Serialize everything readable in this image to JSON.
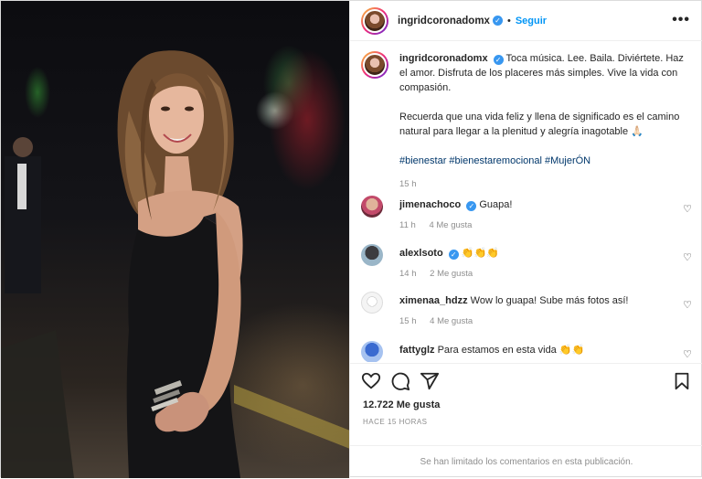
{
  "header": {
    "username": "ingridcoronadomx",
    "separator": "•",
    "follow_label": "Seguir",
    "more_label": "•••"
  },
  "caption": {
    "username": "ingridcoronadomx",
    "text_1": "Toca música. Lee. Baila. Diviértete. Haz el amor. Disfruta de los placeres más simples. Vive la vida con compasión.",
    "text_2": "Recuerda que una vida feliz y llena de significado es el camino natural para llegar a la plenitud y alegría inagotable 🙏🏻",
    "hashtags": "#bienestar #bienestaremocional #MujerÓN",
    "time": "15 h"
  },
  "comments": [
    {
      "username": "jimenachoco",
      "verified": true,
      "text": "Guapa!",
      "time": "11 h",
      "likes": "4 Me gusta"
    },
    {
      "username": "alexlsoto",
      "verified": true,
      "text": "👏👏👏",
      "time": "14 h",
      "likes": "2 Me gusta"
    },
    {
      "username": "ximenaa_hdzz",
      "verified": false,
      "text": "Wow lo guapa! Sube más fotos así!",
      "time": "15 h",
      "likes": "4 Me gusta"
    },
    {
      "username": "fattyglz",
      "verified": false,
      "text": "Para estamos en esta vida 👏👏",
      "time": "",
      "likes": ""
    }
  ],
  "likes_count": "12.722 Me gusta",
  "post_date": "HACE 15 HORAS",
  "comments_limited": "Se han limitado los comentarios en esta publicación.",
  "icons": [
    "heart-icon",
    "comment-icon",
    "share-icon",
    "bookmark-icon",
    "more-icon",
    "verified-icon"
  ],
  "colors": {
    "accent": "#0095f6",
    "verified": "#3897f0",
    "hashtag": "#00376b",
    "muted": "#8e8e8e"
  }
}
